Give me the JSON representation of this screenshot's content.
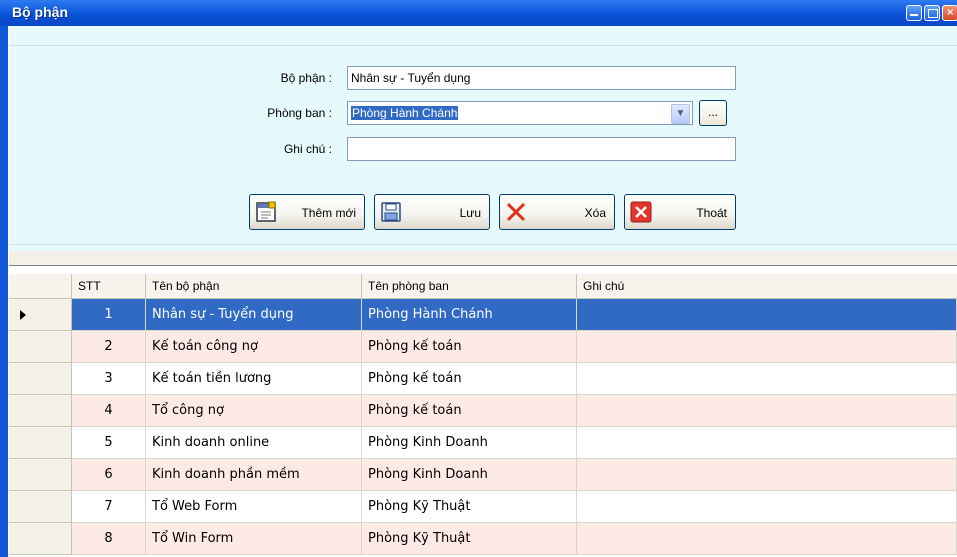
{
  "window": {
    "title": "Bộ phận"
  },
  "form": {
    "bophan_label": "Bộ phận :",
    "bophan_value": "Nhân sự - Tuyển dụng",
    "phongban_label": "Phòng ban :",
    "phongban_value": "Phòng Hành Chánh",
    "browse_label": "...",
    "ghichu_label": "Ghi chú :",
    "ghichu_value": ""
  },
  "buttons": {
    "add": "Thêm mới",
    "save": "Lưu",
    "delete": "Xóa",
    "exit": "Thoát"
  },
  "icons": {
    "add": "new-document-icon",
    "save": "floppy-disk-icon",
    "delete": "red-x-icon",
    "exit": "close-box-icon"
  },
  "colors": {
    "title_bar": "#0a52d8",
    "form_background": "#e6f9fd",
    "selection": "#316ac5",
    "alt_row": "#fdeae4"
  },
  "grid": {
    "columns": [
      "STT",
      "Tên bộ phận",
      "Tên phòng ban",
      "Ghi chú"
    ],
    "selected_index": 0,
    "rows": [
      {
        "stt": "1",
        "name": "Nhân sự - Tuyển dụng",
        "dept": "Phòng Hành Chánh",
        "note": ""
      },
      {
        "stt": "2",
        "name": "Kế toán công nợ",
        "dept": "Phòng kế toán",
        "note": ""
      },
      {
        "stt": "3",
        "name": "Kế toán tiền lương",
        "dept": "Phòng kế toán",
        "note": ""
      },
      {
        "stt": "4",
        "name": "Tổ công nợ",
        "dept": "Phòng kế toán",
        "note": ""
      },
      {
        "stt": "5",
        "name": "Kinh doanh online",
        "dept": "Phòng Kinh Doanh",
        "note": ""
      },
      {
        "stt": "6",
        "name": "Kinh doanh phần mềm",
        "dept": "Phòng Kinh Doanh",
        "note": ""
      },
      {
        "stt": "7",
        "name": "Tổ Web Form",
        "dept": "Phòng Kỹ Thuật",
        "note": ""
      },
      {
        "stt": "8",
        "name": "Tổ Win Form",
        "dept": "Phòng Kỹ Thuật",
        "note": ""
      }
    ]
  }
}
